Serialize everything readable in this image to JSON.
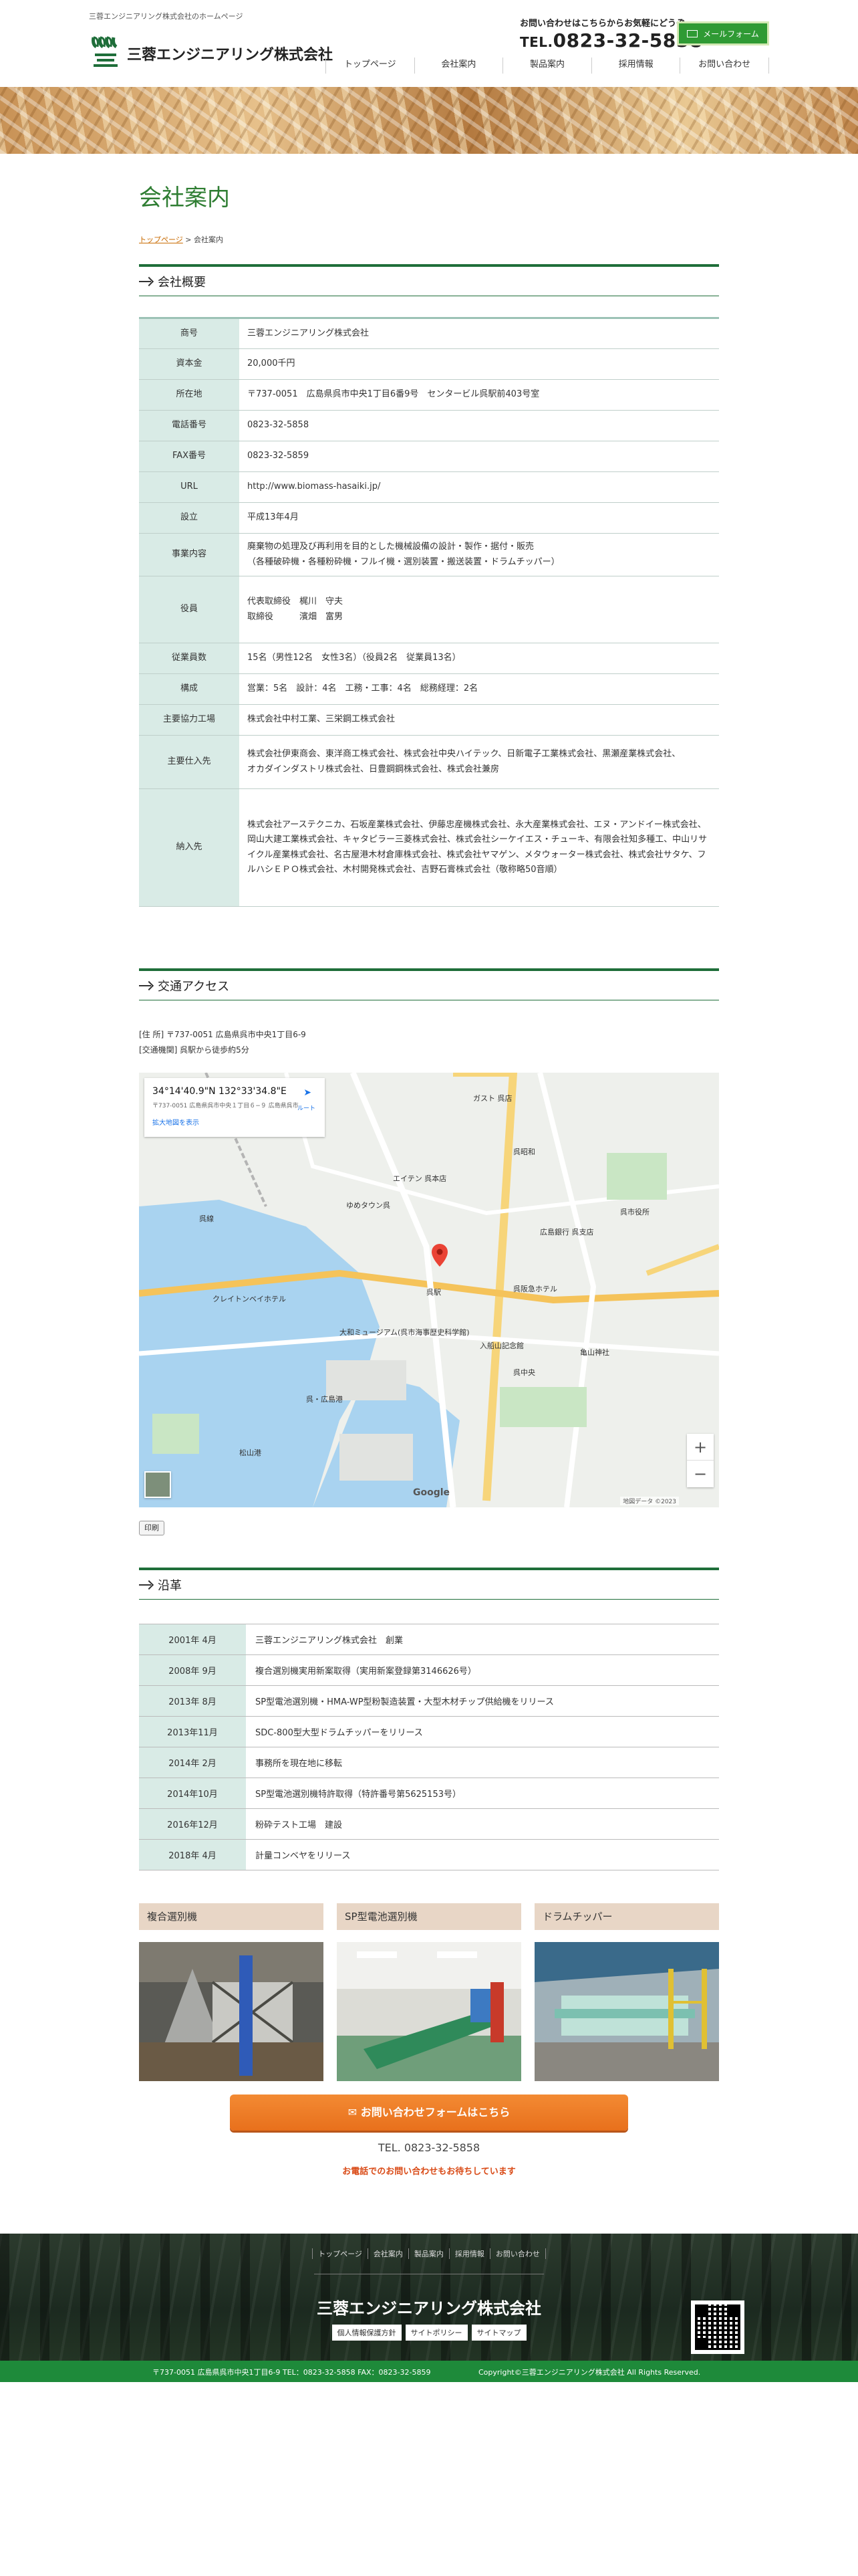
{
  "header": {
    "tagline": "三蓉エンジニアリング株式会社のホームページ",
    "company_name": "三蓉エンジニアリング株式会社",
    "contact_note": "お問い合わせはこちらからお気軽にどうぞ",
    "tel_prefix": "TEL.",
    "tel_number": "0823-32-5858",
    "mail_button": "メールフォーム",
    "nav": [
      "トップページ",
      "会社案内",
      "製品案内",
      "採用情報",
      "お問い合わせ"
    ]
  },
  "page": {
    "title": "会社案内",
    "breadcrumb_home": "トップページ",
    "breadcrumb_sep": ">",
    "breadcrumb_current": "会社案内"
  },
  "overview": {
    "heading": "会社概要",
    "rows": [
      {
        "k": "商号",
        "v": "三蓉エンジニアリング株式会社"
      },
      {
        "k": "資本金",
        "v": "20,000千円"
      },
      {
        "k": "所在地",
        "v": "〒737-0051　広島県呉市中央1丁目6番9号　センタービル呉駅前403号室"
      },
      {
        "k": "電話番号",
        "v": "0823-32-5858"
      },
      {
        "k": "FAX番号",
        "v": "0823-32-5859"
      },
      {
        "k": "URL",
        "v": "http://www.biomass-hasaiki.jp/"
      },
      {
        "k": "設立",
        "v": "平成13年4月"
      },
      {
        "k": "事業内容",
        "v": "廃棄物の処理及び再利用を目的とした機械設備の設計・製作・据付・販売\n（各種破砕機・各種粉砕機・フルイ機・選別装置・搬送装置・ドラムチッパー）"
      },
      {
        "k": "役員",
        "v": "代表取締役　梶川　守夫\n取締役　　　濱畑　富男"
      },
      {
        "k": "従業員数",
        "v": "15名（男性12名　女性3名）（役員2名　従業員13名）"
      },
      {
        "k": "構成",
        "v": "営業：5名　設計：4名　工務・工事：4名　総務経理：2名"
      },
      {
        "k": "主要協力工場",
        "v": "株式会社中村工業、三栄鋼工株式会社"
      },
      {
        "k": "主要仕入先",
        "v": "株式会社伊東商会、東洋商工株式会社、株式会社中央ハイテック、日新電子工業株式会社、黒瀬産業株式会社、\nオカダインダストリ株式会社、日豊鋼鋼株式会社、株式会社兼房"
      },
      {
        "k": "納入先",
        "v": "株式会社アーステクニカ、石坂産業株式会社、伊藤忠産機株式会社、永大産業株式会社、エヌ・アンドイー株式会社、岡山大建工業株式会社、キャタピラー三菱株式会社、株式会社シーケイエス・チューキ、有限会社知多種工、中山リサイクル産業株式会社、名古屋港木材倉庫株式会社、株式会社ヤマゲン、メタウォーター株式会社、株式会社サタケ、フルハシＥＰＯ株式会社、木村開発株式会社、吉野石膏株式会社（敬称略50音順）"
      }
    ]
  },
  "access": {
    "heading": "交通アクセス",
    "address_line": "[住 所] 〒737-0051 広島県呉市中央1丁目6-9",
    "transport_line": "[交通機関] 呉駅から徒歩約5分",
    "map_coord": "34°14'40.9\"N 132°33'34.8\"E",
    "map_addr": "〒737-0051 広島県呉市中央１丁目６−９ 広島県呉市",
    "map_more": "拡大地図を表示",
    "map_dir": "ルート",
    "map_labels": [
      "ガスト 呉店",
      "呉線",
      "エイテン 呉本店",
      "呉昭和",
      "ゆめタウン呉",
      "クレイトンベイホテル",
      "大和ミュージアム(呉市海事歴史科学館)",
      "呉駅",
      "呉阪急ホテル",
      "入船山記念館",
      "亀山神社",
      "呉・広島港",
      "松山港",
      "呉中央",
      "呉市役所",
      "広島銀行 呉支店"
    ],
    "google_label": "Google",
    "map_footer": "地図データ ©2023",
    "print_button": "印刷"
  },
  "history": {
    "heading": "沿革",
    "rows": [
      {
        "d": "2001年 4月",
        "v": "三蓉エンジニアリング株式会社　創業"
      },
      {
        "d": "2008年 9月",
        "v": "複合選別機実用新案取得（実用新案登録第3146626号）"
      },
      {
        "d": "2013年 8月",
        "v": "SP型電池選別機・HMA-WP型粉製造装置・大型木材チップ供給機をリリース"
      },
      {
        "d": "2013年11月",
        "v": "SDC-800型大型ドラムチッパーをリリース"
      },
      {
        "d": "2014年 2月",
        "v": "事務所を現在地に移転"
      },
      {
        "d": "2014年10月",
        "v": "SP型電池選別機特許取得（特許番号第5625153号）"
      },
      {
        "d": "2016年12月",
        "v": "粉砕テスト工場　建設"
      },
      {
        "d": "2018年 4月",
        "v": "計量コンベヤをリリース"
      }
    ]
  },
  "products": [
    {
      "label": "複合選別機"
    },
    {
      "label": "SP型電池選別機"
    },
    {
      "label": "ドラムチッパー"
    }
  ],
  "cta": {
    "button": "お問い合わせフォームはこちら",
    "tel": "TEL. 0823-32-5858",
    "note": "お電話でのお問い合わせもお待ちしています"
  },
  "footer": {
    "nav": [
      "トップページ",
      "会社案内",
      "製品案内",
      "採用情報",
      "お問い合わせ"
    ],
    "company_name": "三蓉エンジニアリング株式会社",
    "links": [
      "個人情報保護方針",
      "サイトポリシー",
      "サイトマップ"
    ],
    "address": "〒737-0051 広島県呉市中央1丁目6-9 TEL：0823-32-5858  FAX：0823-32-5859",
    "copyright": "Copyright©三蓉エンジニアリング株式会社 All Rights Reserved."
  },
  "colors": {
    "brand_green": "#2e7d32",
    "nav_green": "#1f6e3a",
    "table_key_bg": "#d9ebe6",
    "product_label_bg": "#e8d6c6",
    "cta_orange": "#e8701c",
    "footer_bar": "#1e8a3a"
  }
}
